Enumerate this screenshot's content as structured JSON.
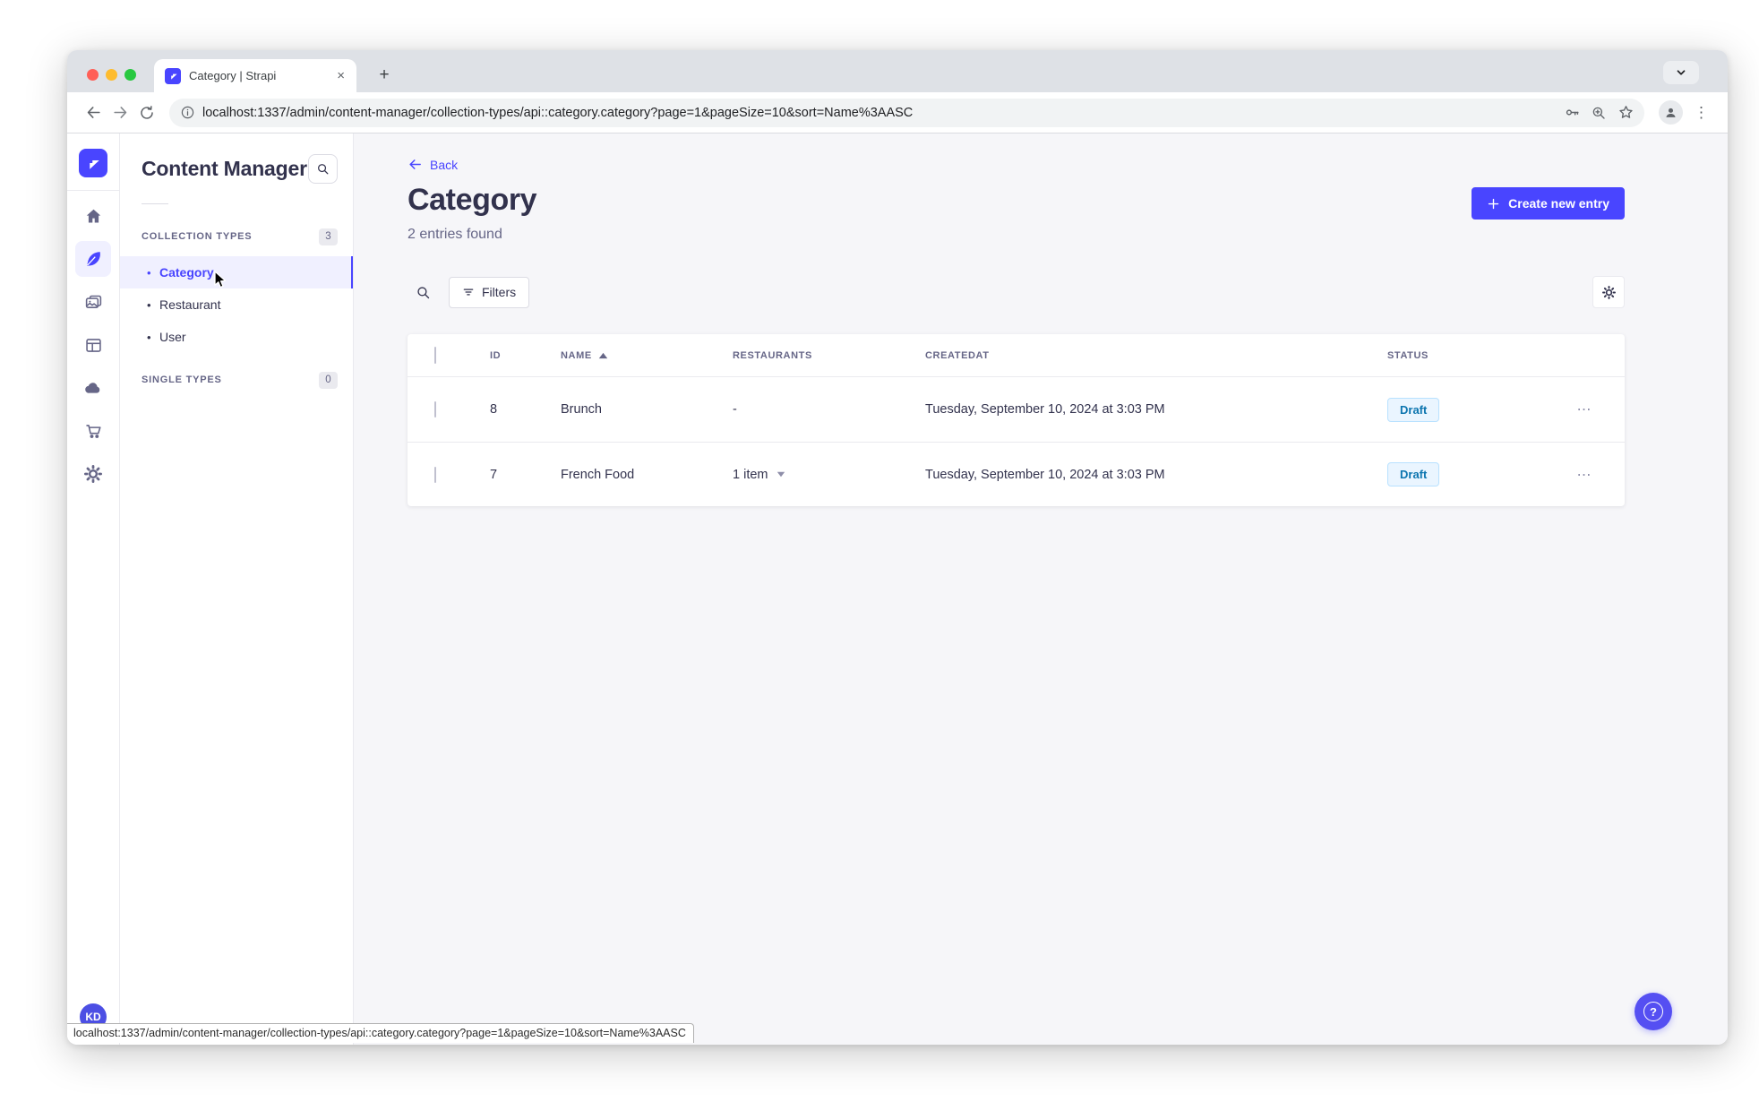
{
  "colors": {
    "primary": "#4945ff",
    "main_bg": "#f6f6f9",
    "draft_bg": "#eaf5ff",
    "draft_border": "#b8e1ff",
    "draft_text": "#0c75af",
    "avatar_bg": "#4c4fe4"
  },
  "browser": {
    "tab_title": "Category | Strapi",
    "close_glyph": "×",
    "new_tab_glyph": "+",
    "menu_glyph": "⋮",
    "url": "localhost:1337/admin/content-manager/collection-types/api::category.category?page=1&pageSize=10&sort=Name%3AASC"
  },
  "status_bar": {
    "url": "localhost:1337/admin/content-manager/collection-types/api::category.category?page=1&pageSize=10&sort=Name%3AASC"
  },
  "nav": {
    "avatar_initials": "KD"
  },
  "subnav": {
    "title": "Content Manager",
    "bullet": "•",
    "collection_types_label": "COLLECTION TYPES",
    "collection_types_count": "3",
    "items": [
      {
        "label": "Category"
      },
      {
        "label": "Restaurant"
      },
      {
        "label": "User"
      }
    ],
    "single_types_label": "SINGLE TYPES",
    "single_types_count": "0"
  },
  "header": {
    "back_label": "Back",
    "title": "Category",
    "subtitle": "2 entries found",
    "create_label": "Create new entry"
  },
  "filters": {
    "label": "Filters"
  },
  "table": {
    "columns": {
      "id": "ID",
      "name": "NAME",
      "restaurants": "RESTAURANTS",
      "createdat": "CREATEDAT",
      "status": "STATUS"
    },
    "rows": [
      {
        "id": "8",
        "name": "Brunch",
        "restaurants": "-",
        "createdat": "Tuesday, September 10, 2024 at 3:03 PM",
        "status": "Draft",
        "more": "⋯"
      },
      {
        "id": "7",
        "name": "French Food",
        "restaurants": "1 item",
        "createdat": "Tuesday, September 10, 2024 at 3:03 PM",
        "status": "Draft",
        "more": "⋯"
      }
    ]
  },
  "help": {
    "glyph": "?"
  }
}
